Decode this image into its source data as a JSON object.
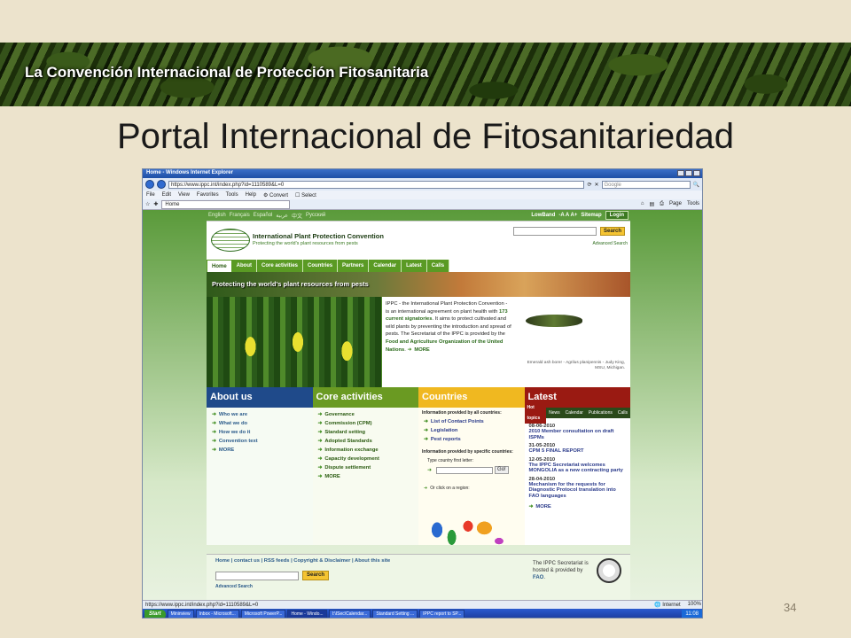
{
  "banner_title": "La Convención Internacional de Protección Fitosanitaria",
  "slide_title": "Portal Internacional de Fitosanitariedad",
  "page_number": "34",
  "browser": {
    "window_title": "Home - Windows Internet Explorer",
    "address": "https://www.ippc.int/index.php?id=1110589&L=0",
    "search_placeholder": "Google",
    "menu": [
      "File",
      "Edit",
      "View",
      "Favorites",
      "Tools",
      "Help"
    ],
    "convert_label": "Convert",
    "select_label": "Select",
    "tab_label": "Home",
    "page_label": "Page",
    "tools_label": "Tools",
    "status_url": "https://www.ippc.int/index.php?id=1110589&L=0",
    "status_zone": "Internet",
    "status_zoom": "100%"
  },
  "site": {
    "languages": [
      "English",
      "Français",
      "Español",
      "عربية",
      "中文",
      "Русский"
    ],
    "lowband": "LowBand",
    "text_size": "-A A A+",
    "sitemap": "Sitemap",
    "login": "Login",
    "org_name": "International Plant Protection Convention",
    "tagline": "Protecting the world's plant resources from pests",
    "search_button": "Search",
    "advanced_search": "Advanced Search",
    "nav": [
      "Home",
      "About",
      "Core activities",
      "Countries",
      "Partners",
      "Calendar",
      "Latest",
      "Calls"
    ],
    "hero_text": "Protecting the world's plant resources from pests",
    "intro": {
      "p1": "IPPC - the International Plant Protection Convention - is an international agreement on plant health with",
      "signatories": "173 current signatories",
      "p2": ". It aims to protect cultivated and wild plants by preventing the introduction and spread of pests. The Secretariat of the IPPC is provided by the",
      "fao": "Food and Agriculture Organization of the United Nations",
      "more": "MORE"
    },
    "bug_caption": "Emerald ash borer - Agrilus planipennis - Judy King, MSU, Michigan.",
    "about": {
      "title": "About us",
      "items": [
        "Who we are",
        "What we do",
        "How we do it",
        "Convention text",
        "MORE"
      ]
    },
    "core": {
      "title": "Core activities",
      "items": [
        "Governance",
        "Commission (CPM)",
        "Standard setting",
        "Adopted Standards",
        "Information exchange",
        "Capacity development",
        "Dispute settlement",
        "MORE"
      ]
    },
    "countries": {
      "title": "Countries",
      "info_all": "Information provided by all countries:",
      "items_all": [
        "List of Contact Points",
        "Legislation",
        "Pest reports"
      ],
      "info_specific": "Information provided by specific countries:",
      "type_letter": "Type country first letter:",
      "go": "Go!",
      "region": "Or click on a region:"
    },
    "latest": {
      "title": "Latest",
      "tabs": [
        "Hot topics",
        "News",
        "Calendar",
        "Publications",
        "Calls"
      ],
      "news": [
        {
          "date": "08-06-2010",
          "title": "2010 Member consultation on draft ISPMs"
        },
        {
          "date": "31-05-2010",
          "title": "CPM 5 FINAL REPORT"
        },
        {
          "date": "12-05-2010",
          "title": "The IPPC Secretariat welcomes MONGOLIA as a new contracting party"
        },
        {
          "date": "28-04-2010",
          "title": "Mechanism for the requests for Diagnostic Protocol translation into FAO languages"
        }
      ],
      "more": "MORE"
    },
    "footer": {
      "links": "Home | contact us | RSS feeds | Copyright & Disclaimer | About this site",
      "search_button": "Search",
      "advanced_search": "Advanced Search",
      "fao_note": "The IPPC Secretariat is hosted & provided by",
      "fao_abbr": "FAO"
    }
  },
  "taskbar": {
    "start": "Start",
    "tasks": [
      "Mininview",
      "Inbox - Microsoft...",
      "Microsoft PowerP...",
      "Home - Windo...",
      "I:\\ISec\\Calendar...",
      "Standard Setting ...",
      "IPPC report to SP..."
    ],
    "clock": "11:08"
  }
}
